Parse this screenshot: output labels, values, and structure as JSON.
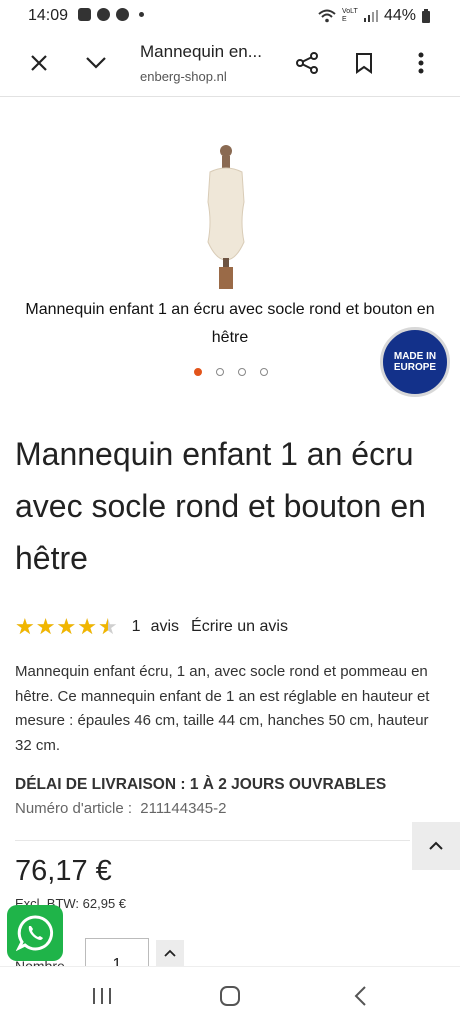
{
  "status_bar": {
    "time": "14:09",
    "battery": "44%",
    "network": "VoLTE",
    "icons": [
      "gallery-icon",
      "snapchat-icon",
      "chrome-icon",
      "dot-icon",
      "wifi-icon",
      "signal-icon",
      "battery-icon"
    ]
  },
  "browser": {
    "title": "Mannequin en...",
    "domain": "​enberg-shop.nl"
  },
  "hero": {
    "caption": "Mannequin enfant 1 an écru avec socle rond et bouton en hêtre",
    "badge_line1": "MADE IN",
    "badge_line2": "EUROPE",
    "slide_count": 4,
    "active_slide": 1
  },
  "product": {
    "title": "Mannequin enfant 1 an écru avec socle rond et bouton en hêtre",
    "rating": 4.5,
    "stars": "★★★★★",
    "review_count": "1",
    "review_label": "avis",
    "write_review": "Écrire un avis",
    "description": "Mannequin enfant écru, 1 an, avec socle rond et pommeau en hêtre. Ce mannequin enfant de 1 an est réglable en hauteur et mesure : épaules 46 cm, taille 44 cm, hanches 50 cm, hauteur 32 cm.",
    "delivery": "DÉLAI DE LIVRAISON : 1 À 2 JOURS OUVRABLES",
    "article_label": "Numéro d'article :",
    "article_number": "211144345-2",
    "price": "76,17 €",
    "excl_btw": "Excl. BTW: 62,95 €",
    "quantity_label": "Nombre",
    "quantity": "1"
  },
  "colors": {
    "star": "#f1b600",
    "active_dot": "#e2541b",
    "whatsapp": "#1fb449",
    "badge": "#13318a"
  }
}
